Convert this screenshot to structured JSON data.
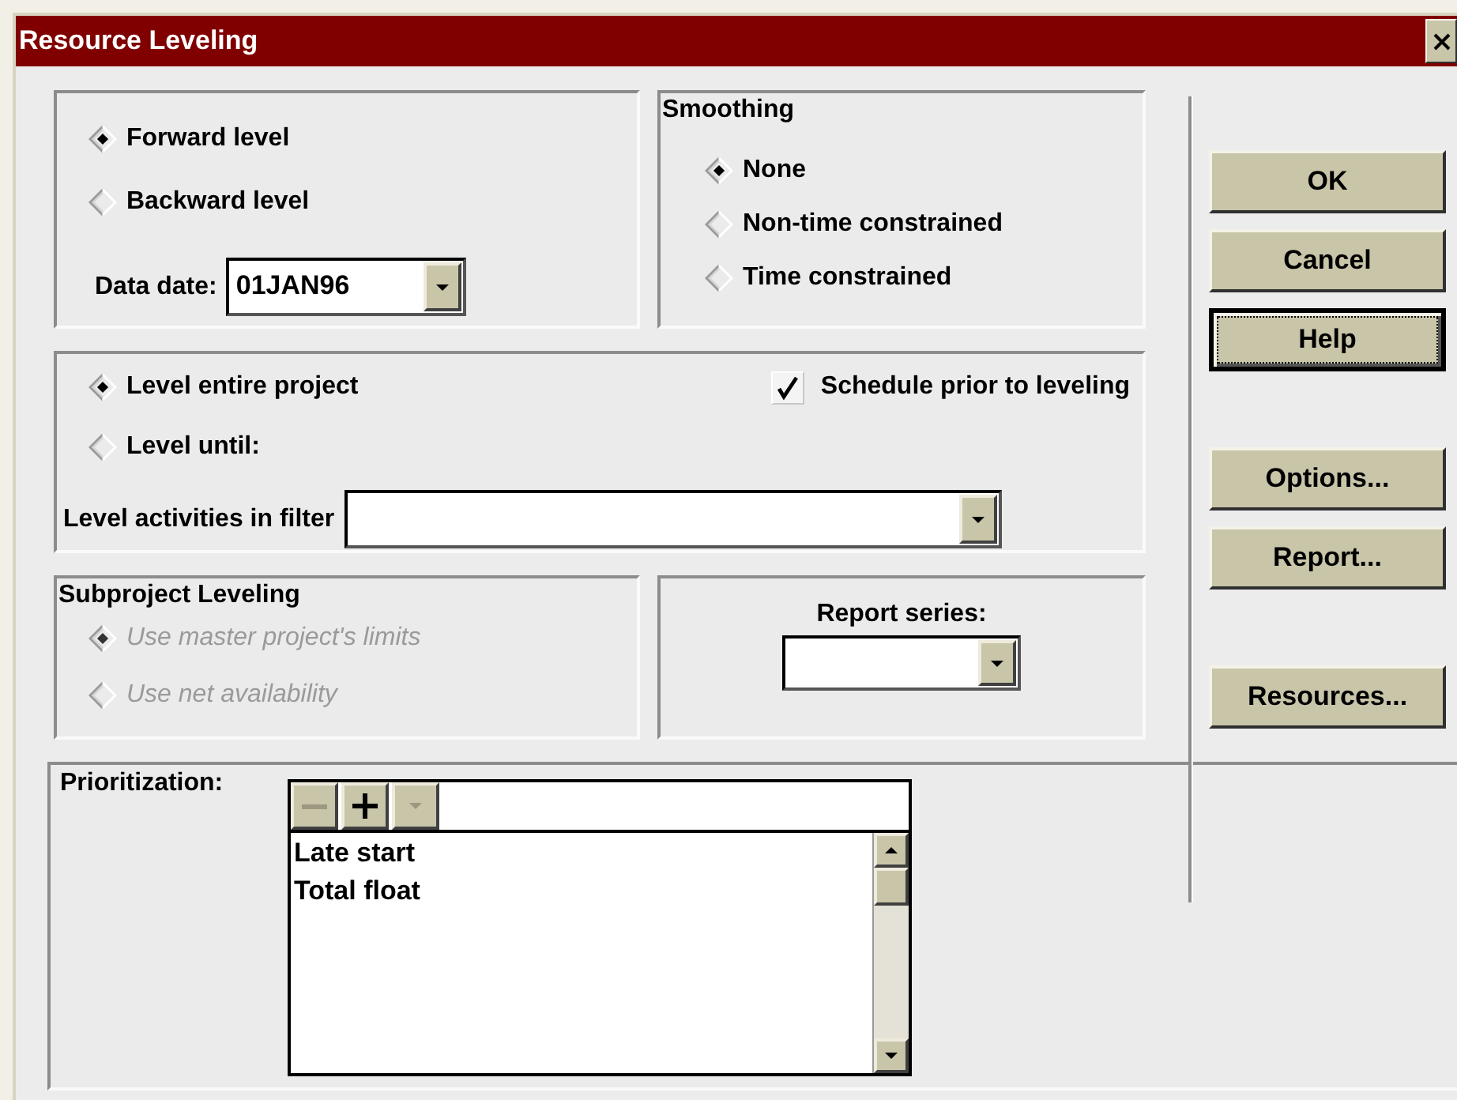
{
  "window": {
    "title": "Resource Leveling"
  },
  "direction": {
    "options": [
      {
        "label": "Forward level",
        "selected": true
      },
      {
        "label": "Backward level",
        "selected": false
      }
    ],
    "data_date": {
      "label": "Data date:",
      "value": "01JAN96"
    }
  },
  "smoothing": {
    "title": "Smoothing",
    "options": [
      {
        "label": "None",
        "selected": true
      },
      {
        "label": "Non-time constrained",
        "selected": false
      },
      {
        "label": "Time constrained",
        "selected": false
      }
    ]
  },
  "scope": {
    "options": [
      {
        "label": "Level entire project",
        "selected": true
      },
      {
        "label": "Level until:",
        "selected": false
      }
    ],
    "schedule_prior": {
      "label": "Schedule prior to leveling",
      "checked": true
    },
    "filter": {
      "label": "Level activities in filter"
    }
  },
  "subproject": {
    "title": "Subproject Leveling",
    "disabled": true,
    "options": [
      {
        "label": "Use master project's limits",
        "selected": true
      },
      {
        "label": "Use net availability",
        "selected": false
      }
    ]
  },
  "report_series": {
    "label": "Report series:"
  },
  "prioritization": {
    "label": "Prioritization:",
    "toolbar": [
      {
        "kind": "remove",
        "disabled": true
      },
      {
        "kind": "add",
        "disabled": false
      },
      {
        "kind": "menu",
        "disabled": true
      }
    ],
    "items": [
      "Late start",
      "Total float"
    ]
  },
  "button_groups": [
    [
      {
        "label": "OK",
        "focused": false
      },
      {
        "label": "Cancel",
        "focused": false
      },
      {
        "label": "Help",
        "focused": true
      }
    ],
    [
      {
        "label": "Options...",
        "focused": false
      },
      {
        "label": "Report...",
        "focused": false
      }
    ],
    [
      {
        "label": "Resources...",
        "focused": false
      }
    ]
  ]
}
